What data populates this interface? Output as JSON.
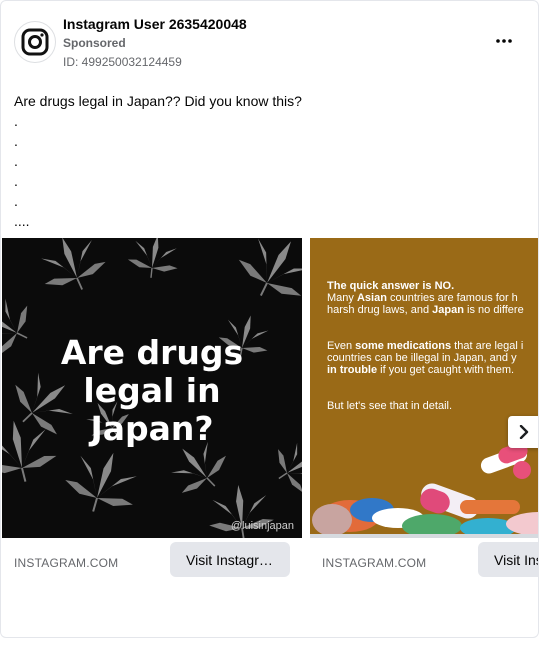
{
  "post": {
    "author": "Instagram User 2635420048",
    "sponsored_label": "Sponsored",
    "ad_id": "ID: 499250032124459",
    "more_icon": "more-horizontal-icon",
    "body_lines": [
      "Are drugs legal in Japan?? Did you know this?",
      ".",
      ".",
      ".",
      ".",
      ".",
      "...."
    ]
  },
  "carousel": {
    "slides": [
      {
        "image_text_lines": [
          "Are drugs",
          "legal in",
          "Japan?"
        ],
        "watermark": "@luisinjapan",
        "domain": "INSTAGRAM.COM",
        "button_label": "Visit Instagr…"
      },
      {
        "domain": "INSTAGRAM.COM",
        "button_label": "Visit Ins",
        "image_text": {
          "l1_bold": "The quick answer is NO.",
          "l2_a": "Many ",
          "l2_b": "Asian",
          "l2_c": " countries are famous for h",
          "l3_a": "harsh drug laws, and ",
          "l3_b": "Japan",
          "l3_c": " is no differe",
          "l4_a": "Even ",
          "l4_b": "some medications",
          "l4_c": " that are legal i",
          "l5": "countries can be illegal in Japan, and y",
          "l6_a": "in trouble",
          "l6_b": " if you get caught with them.",
          "l7": "But let's see that in detail."
        }
      }
    ],
    "next_icon": "chevron-right-icon"
  },
  "colors": {
    "slide1_bg": "#0b0b0b",
    "slide2_bg": "#9a6a17",
    "button_bg": "#e4e6eb"
  }
}
